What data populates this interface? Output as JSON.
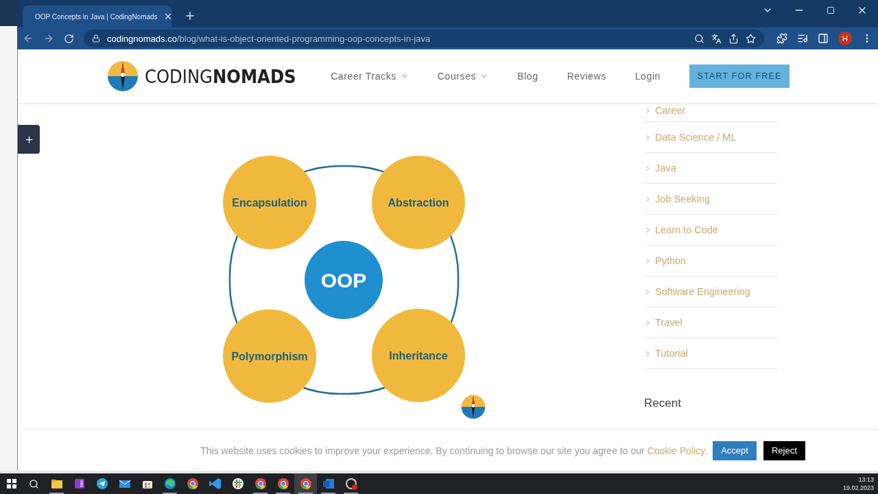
{
  "browser": {
    "tab": {
      "title": "OOP Concepts in Java | CodingNomads",
      "selected": true
    },
    "address": {
      "domain": "codingnomads.co",
      "path": "/blog/what-is-object-oriented-programming-oop-concepts-in-java"
    },
    "profile": "H"
  },
  "site": {
    "logo": "CODING**NOMADS**",
    "nav": [
      {
        "label": "Career Tracks",
        "dropdown": true
      },
      {
        "label": "Courses",
        "dropdown": true
      },
      {
        "label": "Blog",
        "dropdown": false
      },
      {
        "label": "Reviews",
        "dropdown": false
      },
      {
        "label": "Login",
        "dropdown": false
      }
    ],
    "cta": "START FOR FREE"
  },
  "diagram": {
    "center": "OOP",
    "concepts": [
      "Encapsulation",
      "Abstraction",
      "Polymorphism",
      "Inheritance"
    ]
  },
  "sidebar": {
    "categories": [
      "Career",
      "Data Science / ML",
      "Java",
      "Job Seeking",
      "Learn to Code",
      "Python",
      "Software Engineering",
      "Travel",
      "Tutorial"
    ],
    "heading": "Recent"
  },
  "cookie": {
    "text": "This website uses cookies to improve your experience. By continuing to browse our site you agree to our",
    "link": "Cookie Policy.",
    "accept": "Accept",
    "reject": "Reject"
  },
  "taskbar": {
    "apps": [
      {
        "kind": "explorer",
        "running": true,
        "selected": false
      },
      {
        "kind": "onenote",
        "running": false,
        "selected": false
      },
      {
        "kind": "telegram",
        "running": false,
        "selected": false
      },
      {
        "kind": "mail",
        "running": false,
        "selected": false
      },
      {
        "kind": "store",
        "running": false,
        "selected": false
      },
      {
        "kind": "edge",
        "running": true,
        "selected": false
      },
      {
        "kind": "chrome",
        "running": false,
        "selected": false
      },
      {
        "kind": "vscode",
        "running": false,
        "selected": false
      },
      {
        "kind": "slack",
        "running": false,
        "selected": false
      },
      {
        "kind": "chrome",
        "running": true,
        "selected": false
      },
      {
        "kind": "chrome",
        "running": true,
        "selected": false
      },
      {
        "kind": "chrome",
        "running": true,
        "selected": true
      },
      {
        "kind": "word",
        "running": true,
        "selected": false
      },
      {
        "kind": "recorder",
        "running": true,
        "selected": false
      }
    ],
    "time": "13:13",
    "date": "19.02.2023"
  }
}
